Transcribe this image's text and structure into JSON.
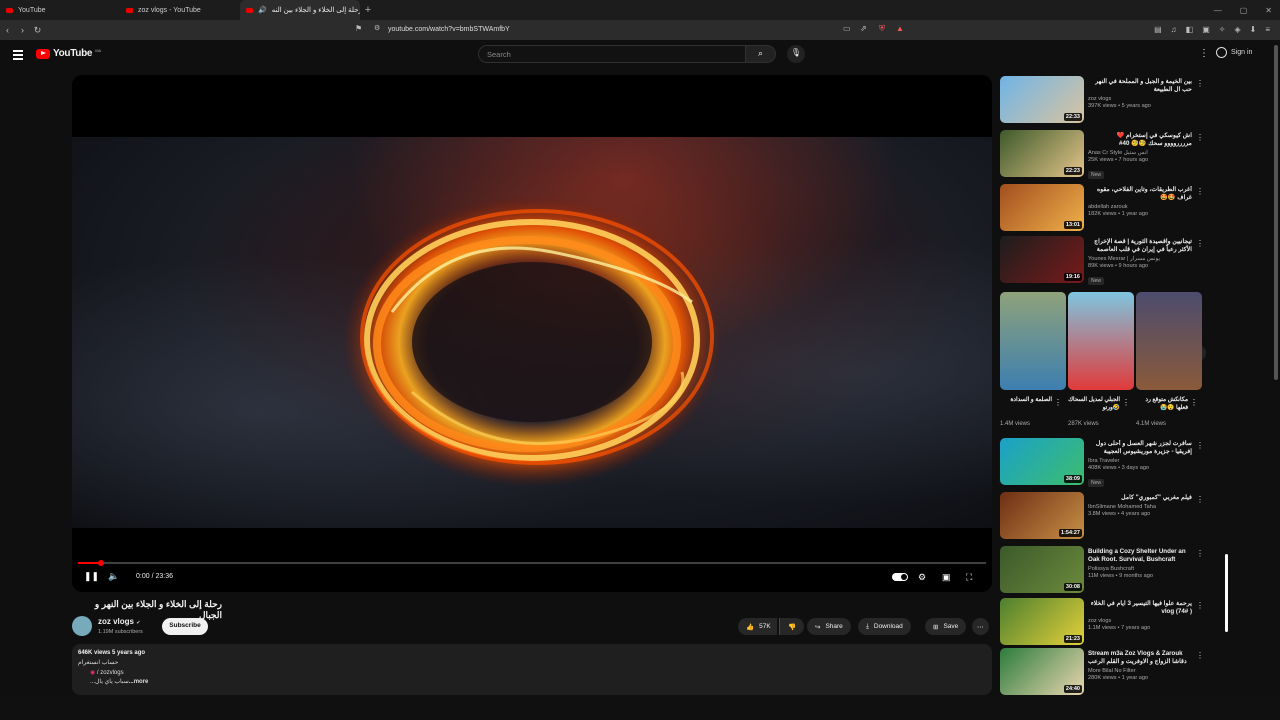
{
  "browser": {
    "tabs": [
      {
        "label": "YouTube"
      },
      {
        "label": "zoz vlogs - YouTube"
      },
      {
        "label": "رحلة إلى الخلاء و الجلاء بين النه"
      }
    ],
    "new_tab": "+",
    "url": "youtube.com/watch?v=bmbSTWAmfbY"
  },
  "header": {
    "logo_text": "YouTube",
    "logo_country": "MA",
    "search_placeholder": "Search",
    "sign_in": "Sign in"
  },
  "player": {
    "time": "0:00 / 23:36",
    "progress_fraction": 0.025
  },
  "video": {
    "title": "رحلة إلى الخلاء و الجلاء بين النهر و الجبال",
    "channel": "zoz vlogs",
    "subscribers": "1.19M subscribers",
    "subscribe_label": "Subscribe",
    "likes": "57K",
    "share_label": "Share",
    "download_label": "Download",
    "save_label": "Save"
  },
  "description": {
    "meta": "646K views  5 years ago",
    "line1": "حساب انستغرام",
    "line2": "/ zozvlogs",
    "line3": "...سباب ياي يال",
    "more": "...more"
  },
  "recommended": [
    {
      "title": "بين الخيمة و الجبل و المملحة في النهر حب ال الطبيعة",
      "channel": "zoz vlogs",
      "views": "397K views • 5 years ago",
      "duration": "22:33",
      "new": "",
      "colors": [
        "#6fb4e6",
        "#d9c4a0"
      ]
    },
    {
      "title": "اش كيوسكي في إستخرام ❤️ مرررروووو سحك 🧐🧐 40#",
      "channel": "Anas Cr Style انس ستيل",
      "views": "25K views • 7 hours ago",
      "duration": "22:23",
      "new": "New",
      "colors": [
        "#3d5a2a",
        "#e4c48a"
      ]
    },
    {
      "title": "أغرب الطريقات، وتاين الفلاحي، مقوه غراف 🤩🤩",
      "channel": "abdellah zarouk",
      "views": "182K views • 1 year ago",
      "duration": "13:01",
      "new": "",
      "colors": [
        "#a24e1e",
        "#f0b14a"
      ]
    },
    {
      "title": "تيجانيين واقصيدة الثورية | قصة الإخراج الأكثر رعباً في إيران في قلب العاصمة",
      "channel": "Younes Mesrar | يونس مسرار",
      "views": "89K views • 9 hours ago",
      "duration": "19:16",
      "new": "New",
      "colors": [
        "#1d1d1d",
        "#7a1a1a"
      ]
    },
    {
      "title": "سافرت لجزر شهر العسل و أحلى دول إفريقيا - جزيرة موريشيوس العجيبة",
      "channel": "Ibra Traveler",
      "views": "408K views • 3 days ago",
      "duration": "38:09",
      "new": "New",
      "colors": [
        "#1aa1c8",
        "#3dbd6e"
      ]
    },
    {
      "title": "فيلم مغربي \"كمبوري\" كامل",
      "channel": "IbnSlimane Mohamed Taha",
      "views": "3.8M views • 4 years ago",
      "duration": "1:54:27",
      "new": "",
      "colors": [
        "#6e2e14",
        "#c89046"
      ]
    },
    {
      "title": "Building a Cozy Shelter Under an Oak Root. Survival, Bushcraft",
      "channel": "Polissya Bushcraft",
      "views": "11M views • 9 months ago",
      "duration": "30:08",
      "new": "",
      "colors": [
        "#3b5a2a",
        "#6d8a3c"
      ]
    },
    {
      "title": "يرحمة علوا فيها التيسير 3 ايام في الخلاء ( vlog (74#",
      "channel": "zoz vlogs",
      "views": "1.1M views • 7 years ago",
      "duration": "21:23",
      "new": "",
      "colors": [
        "#4c7f2e",
        "#e4d13a"
      ]
    },
    {
      "title": "Stream m3a Zoz Vlogs & Zarouk دقاشا الزواج و الاوفريت و القلم الرعب",
      "channel": "More Bilal No Filter",
      "views": "280K views • 1 year ago",
      "duration": "24:40",
      "new": "",
      "colors": [
        "#2c7c3c",
        "#ead6b0"
      ]
    }
  ],
  "shorts": [
    {
      "title": "الصلمة و السدادة",
      "views": "1.4M views",
      "colors": [
        "#8fa27a",
        "#3c7fb0"
      ]
    },
    {
      "title": "الجبلي لمديل السحاك 🤣ورتو",
      "views": "287K views",
      "colors": [
        "#7fc6e0",
        "#e03a3a"
      ]
    },
    {
      "title": "مكانكش متوقع رد فعلها 😯😭",
      "views": "4.1M views",
      "colors": [
        "#4c4c6e",
        "#8a5a3a"
      ]
    }
  ]
}
